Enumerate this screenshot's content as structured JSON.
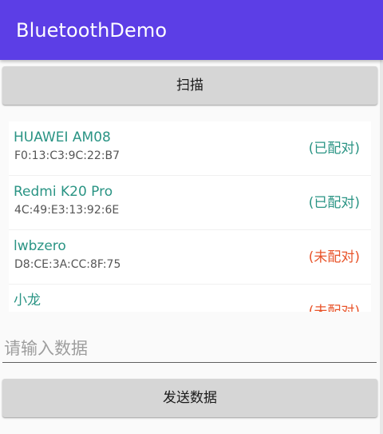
{
  "app": {
    "title": "BluetoothDemo",
    "accent_color": "#5c3ee6"
  },
  "scan_button": {
    "label": "扫描"
  },
  "devices": [
    {
      "name": "HUAWEI AM08",
      "address": "F0:13:C3:9C:22:B7",
      "status": "(已配对)",
      "status_color": "#2a9484"
    },
    {
      "name": "Redmi K20 Pro",
      "address": "4C:49:E3:13:92:6E",
      "status": "(已配对)",
      "status_color": "#2a9484"
    },
    {
      "name": "lwbzero",
      "address": "D8:CE:3A:CC:8F:75",
      "status": "(未配对)",
      "status_color": "#e8542a"
    },
    {
      "name": "小龙",
      "address": "",
      "status": "(未配对)",
      "status_color": "#e8542a"
    }
  ],
  "data_input": {
    "placeholder": "请输入数据",
    "value": ""
  },
  "send_button": {
    "label": "发送数据"
  }
}
